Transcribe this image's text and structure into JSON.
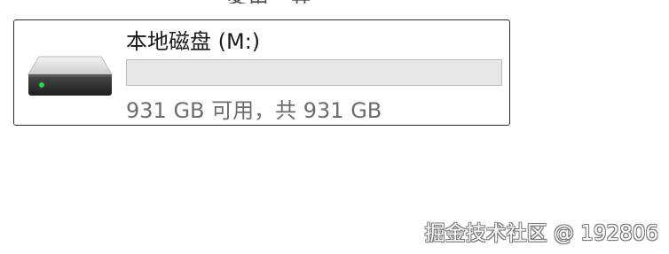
{
  "drive": {
    "title": "本地磁盘 (M:)",
    "space_text": "931 GB 可用，共 931 GB",
    "used_fraction": 0.0,
    "icon": "hard-drive-icon",
    "accent": "#26a0da"
  },
  "watermark": {
    "text": "掘金技术社区 @ 192806"
  }
}
